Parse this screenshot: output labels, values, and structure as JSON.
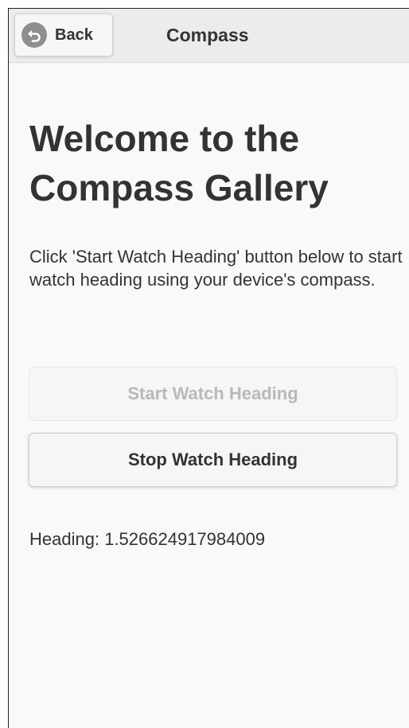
{
  "header": {
    "back_label": "Back",
    "title": "Compass"
  },
  "main": {
    "title": "Welcome to the Compass Gallery",
    "intro": "Click 'Start Watch Heading' button below to start watch heading using your device's compass.",
    "start_button_label": "Start Watch Heading",
    "stop_button_label": "Stop Watch Heading",
    "heading_label": "Heading:",
    "heading_value": "1.526624917984009"
  },
  "icons": {
    "back": "back-arrow-icon"
  },
  "colors": {
    "header_bg": "#ececec",
    "page_bg": "#f9f9f9",
    "text": "#333333",
    "disabled_text": "#b9b9b9",
    "back_icon": "#8e8e8e"
  }
}
